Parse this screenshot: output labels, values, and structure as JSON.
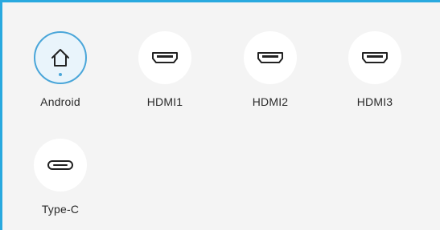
{
  "panel": {
    "accent_color": "#29a9df",
    "background": "#f4f4f4",
    "selected_color": "#4aa6d9"
  },
  "sources": [
    {
      "label": "Android",
      "icon": "home-icon",
      "selected": true
    },
    {
      "label": "HDMI1",
      "icon": "hdmi-port-icon",
      "selected": false
    },
    {
      "label": "HDMI2",
      "icon": "hdmi-port-icon",
      "selected": false
    },
    {
      "label": "HDMI3",
      "icon": "hdmi-port-icon",
      "selected": false
    },
    {
      "label": "Type-C",
      "icon": "usb-c-port-icon",
      "selected": false
    }
  ]
}
